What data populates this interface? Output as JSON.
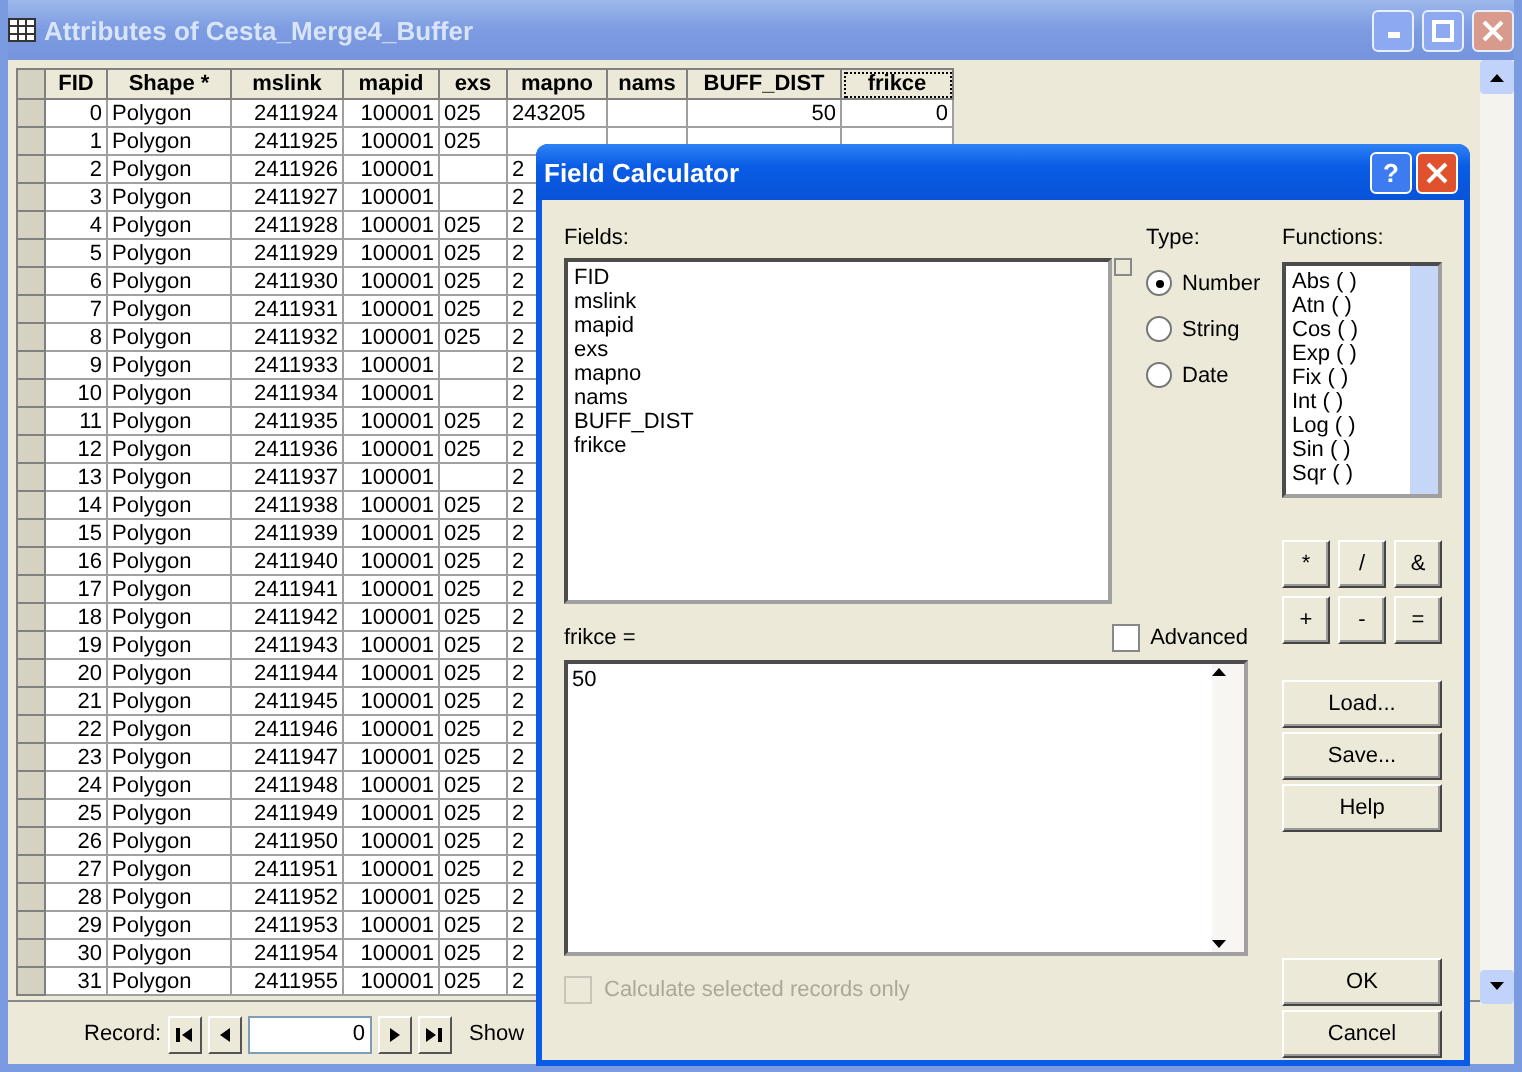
{
  "window": {
    "title": "Attributes of Cesta_Merge4_Buffer"
  },
  "table": {
    "columns": [
      {
        "label": "FID",
        "selected": false
      },
      {
        "label": "Shape *",
        "selected": false
      },
      {
        "label": "mslink",
        "selected": false
      },
      {
        "label": "mapid",
        "selected": false
      },
      {
        "label": "exs",
        "selected": false
      },
      {
        "label": "mapno",
        "selected": false
      },
      {
        "label": "nams",
        "selected": false
      },
      {
        "label": "BUFF_DIST",
        "selected": false
      },
      {
        "label": "frikce",
        "selected": true
      }
    ],
    "rows": [
      {
        "cells": [
          "0",
          "Polygon",
          "2411924",
          "100001",
          "025",
          "243205",
          null,
          "50",
          "0"
        ]
      },
      {
        "cells": [
          "1",
          "Polygon",
          "2411925",
          "100001",
          "025"
        ]
      },
      {
        "cells": [
          "2",
          "Polygon",
          "2411926",
          "100001",
          null,
          "2"
        ]
      },
      {
        "cells": [
          "3",
          "Polygon",
          "2411927",
          "100001",
          null,
          "2"
        ]
      },
      {
        "cells": [
          "4",
          "Polygon",
          "2411928",
          "100001",
          "025",
          "2"
        ]
      },
      {
        "cells": [
          "5",
          "Polygon",
          "2411929",
          "100001",
          "025",
          "2"
        ]
      },
      {
        "cells": [
          "6",
          "Polygon",
          "2411930",
          "100001",
          "025",
          "2"
        ]
      },
      {
        "cells": [
          "7",
          "Polygon",
          "2411931",
          "100001",
          "025",
          "2"
        ]
      },
      {
        "cells": [
          "8",
          "Polygon",
          "2411932",
          "100001",
          "025",
          "2"
        ]
      },
      {
        "cells": [
          "9",
          "Polygon",
          "2411933",
          "100001",
          null,
          "2"
        ]
      },
      {
        "cells": [
          "10",
          "Polygon",
          "2411934",
          "100001",
          null,
          "2"
        ]
      },
      {
        "cells": [
          "11",
          "Polygon",
          "2411935",
          "100001",
          "025",
          "2"
        ]
      },
      {
        "cells": [
          "12",
          "Polygon",
          "2411936",
          "100001",
          "025",
          "2"
        ]
      },
      {
        "cells": [
          "13",
          "Polygon",
          "2411937",
          "100001",
          null,
          "2"
        ]
      },
      {
        "cells": [
          "14",
          "Polygon",
          "2411938",
          "100001",
          "025",
          "2"
        ]
      },
      {
        "cells": [
          "15",
          "Polygon",
          "2411939",
          "100001",
          "025",
          "2"
        ]
      },
      {
        "cells": [
          "16",
          "Polygon",
          "2411940",
          "100001",
          "025",
          "2"
        ]
      },
      {
        "cells": [
          "17",
          "Polygon",
          "2411941",
          "100001",
          "025",
          "2"
        ]
      },
      {
        "cells": [
          "18",
          "Polygon",
          "2411942",
          "100001",
          "025",
          "2"
        ]
      },
      {
        "cells": [
          "19",
          "Polygon",
          "2411943",
          "100001",
          "025",
          "2"
        ]
      },
      {
        "cells": [
          "20",
          "Polygon",
          "2411944",
          "100001",
          "025",
          "2"
        ]
      },
      {
        "cells": [
          "21",
          "Polygon",
          "2411945",
          "100001",
          "025",
          "2"
        ]
      },
      {
        "cells": [
          "22",
          "Polygon",
          "2411946",
          "100001",
          "025",
          "2"
        ]
      },
      {
        "cells": [
          "23",
          "Polygon",
          "2411947",
          "100001",
          "025",
          "2"
        ]
      },
      {
        "cells": [
          "24",
          "Polygon",
          "2411948",
          "100001",
          "025",
          "2"
        ]
      },
      {
        "cells": [
          "25",
          "Polygon",
          "2411949",
          "100001",
          "025",
          "2"
        ]
      },
      {
        "cells": [
          "26",
          "Polygon",
          "2411950",
          "100001",
          "025",
          "2"
        ]
      },
      {
        "cells": [
          "27",
          "Polygon",
          "2411951",
          "100001",
          "025",
          "2"
        ]
      },
      {
        "cells": [
          "28",
          "Polygon",
          "2411952",
          "100001",
          "025",
          "2"
        ]
      },
      {
        "cells": [
          "29",
          "Polygon",
          "2411953",
          "100001",
          "025",
          "2"
        ]
      },
      {
        "cells": [
          "30",
          "Polygon",
          "2411954",
          "100001",
          "025",
          "2"
        ]
      },
      {
        "cells": [
          "31",
          "Polygon",
          "2411955",
          "100001",
          "025",
          "2"
        ]
      }
    ]
  },
  "record_bar": {
    "label": "Record:",
    "value": "0",
    "show_label": "Show"
  },
  "dialog": {
    "title": "Field Calculator",
    "help_glyph": "?",
    "fields_label": "Fields:",
    "fields": [
      "FID",
      "mslink",
      "mapid",
      "exs",
      "mapno",
      "nams",
      "BUFF_DIST",
      "frikce"
    ],
    "type_label": "Type:",
    "types": [
      {
        "label": "Number",
        "selected": true
      },
      {
        "label": "String",
        "selected": false
      },
      {
        "label": "Date",
        "selected": false
      }
    ],
    "functions_label": "Functions:",
    "functions": [
      "Abs ( )",
      "Atn ( )",
      "Cos ( )",
      "Exp ( )",
      "Fix ( )",
      "Int ( )",
      "Log ( )",
      "Sin ( )",
      "Sqr ( )"
    ],
    "operators": [
      "*",
      "/",
      "&",
      "+",
      "-",
      "="
    ],
    "expression_label": "frikce =",
    "advanced": {
      "label": "Advanced",
      "checked": false
    },
    "expression": "50",
    "side_buttons": [
      "Load...",
      "Save...",
      "Help"
    ],
    "selected_only": {
      "label": "Calculate selected records only",
      "checked": false,
      "disabled": true
    },
    "ok": "OK",
    "cancel": "Cancel"
  }
}
